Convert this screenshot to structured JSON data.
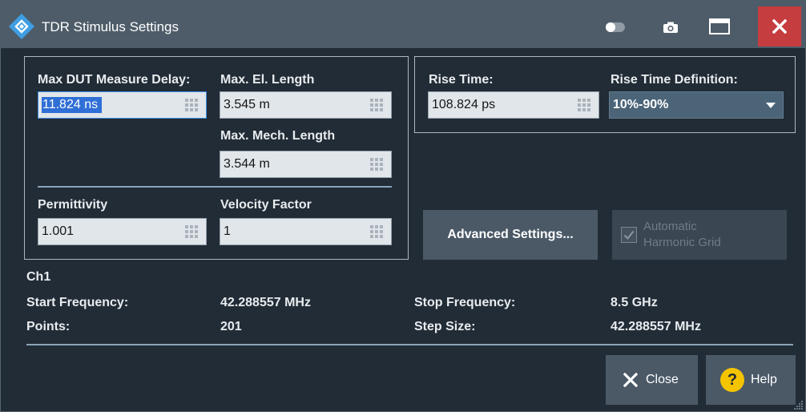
{
  "window": {
    "title": "TDR Stimulus Settings",
    "icons": [
      "rs-logo-icon",
      "toggle-icon",
      "camera-icon",
      "maximize-icon",
      "close-icon"
    ]
  },
  "distance_group": {
    "max_dut_measure_delay": {
      "label": "Max DUT Measure Delay:",
      "value": "11.824 ns",
      "text_selected": true
    },
    "max_el_length": {
      "label": "Max. El. Length",
      "value": "3.545 m"
    },
    "max_mech_length": {
      "label": "Max. Mech. Length",
      "value": "3.544 m"
    },
    "permittivity": {
      "label": "Permittivity",
      "value": "1.001"
    },
    "velocity_factor": {
      "label": "Velocity Factor",
      "value": "1"
    }
  },
  "rise_group": {
    "rise_time": {
      "label": "Rise Time:",
      "value": "108.824 ps"
    },
    "rise_time_definition": {
      "label": "Rise Time Definition:",
      "selected": "10%-90%"
    }
  },
  "advanced_settings_button": {
    "label": "Advanced Settings..."
  },
  "automatic_harmonic_grid": {
    "label_lines": [
      "Automatic",
      "Harmonic Grid"
    ],
    "checked": true,
    "enabled": false
  },
  "channel_info": {
    "channel": "Ch1",
    "start_frequency": {
      "label": "Start Frequency:",
      "value": "42.288557 MHz"
    },
    "stop_frequency": {
      "label": "Stop Frequency:",
      "value": "8.5 GHz"
    },
    "points": {
      "label": "Points:",
      "value": "201"
    },
    "step_size": {
      "label": "Step Size:",
      "value": "42.288557 MHz"
    }
  },
  "footer": {
    "close_button": {
      "label": "Close",
      "icon": "close-x-icon"
    },
    "help_button": {
      "label": "Help",
      "icon": "help-icon"
    }
  },
  "colors": {
    "titlebar": "#4e5c69",
    "window_background": "#222c36",
    "close_button": "#c53d3e",
    "help_icon": "#f5c400",
    "selection": "#2f6fd6"
  }
}
